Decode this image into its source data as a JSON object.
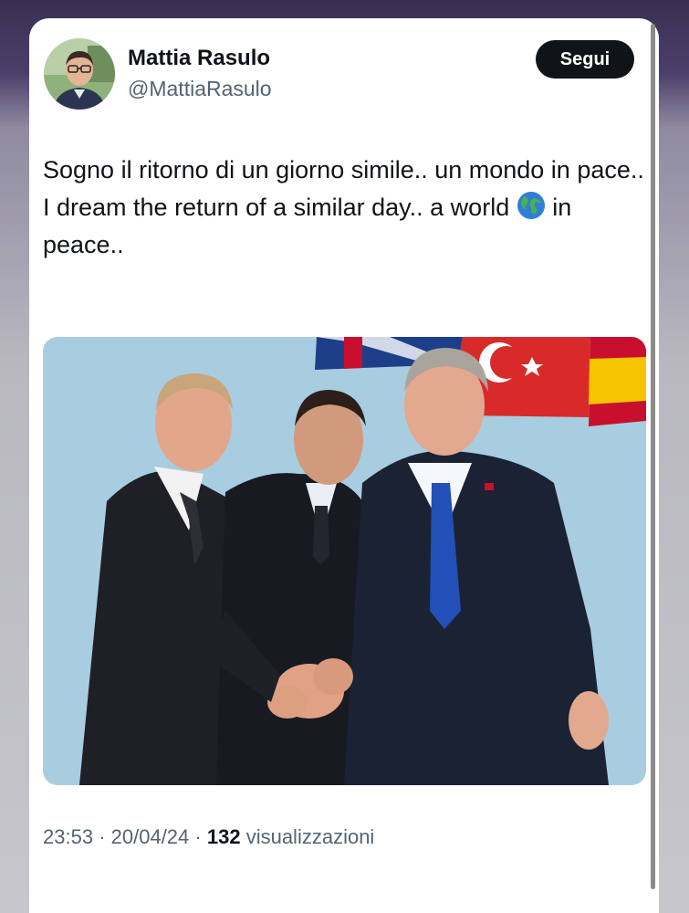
{
  "author": {
    "display_name": "Mattia Rasulo",
    "handle": "@MattiaRasulo",
    "avatar_icon": "user-avatar"
  },
  "follow_button": {
    "label": "Segui"
  },
  "tweet": {
    "text_it": "Sogno il ritorno di un giorno simile.. un mondo in pace..",
    "text_en_before": "I dream the return of a similar day.. a world",
    "emoji_icon": "globe-icon",
    "text_en_after": "in peace.."
  },
  "meta": {
    "time": "23:53",
    "separator": "·",
    "date": "20/04/24",
    "views_count": "132",
    "views_label": "visualizzazioni"
  },
  "colors": {
    "text_primary": "#0f1419",
    "text_secondary": "#536471",
    "button_bg": "#0f1419",
    "media_bg": "#a9cde0"
  }
}
